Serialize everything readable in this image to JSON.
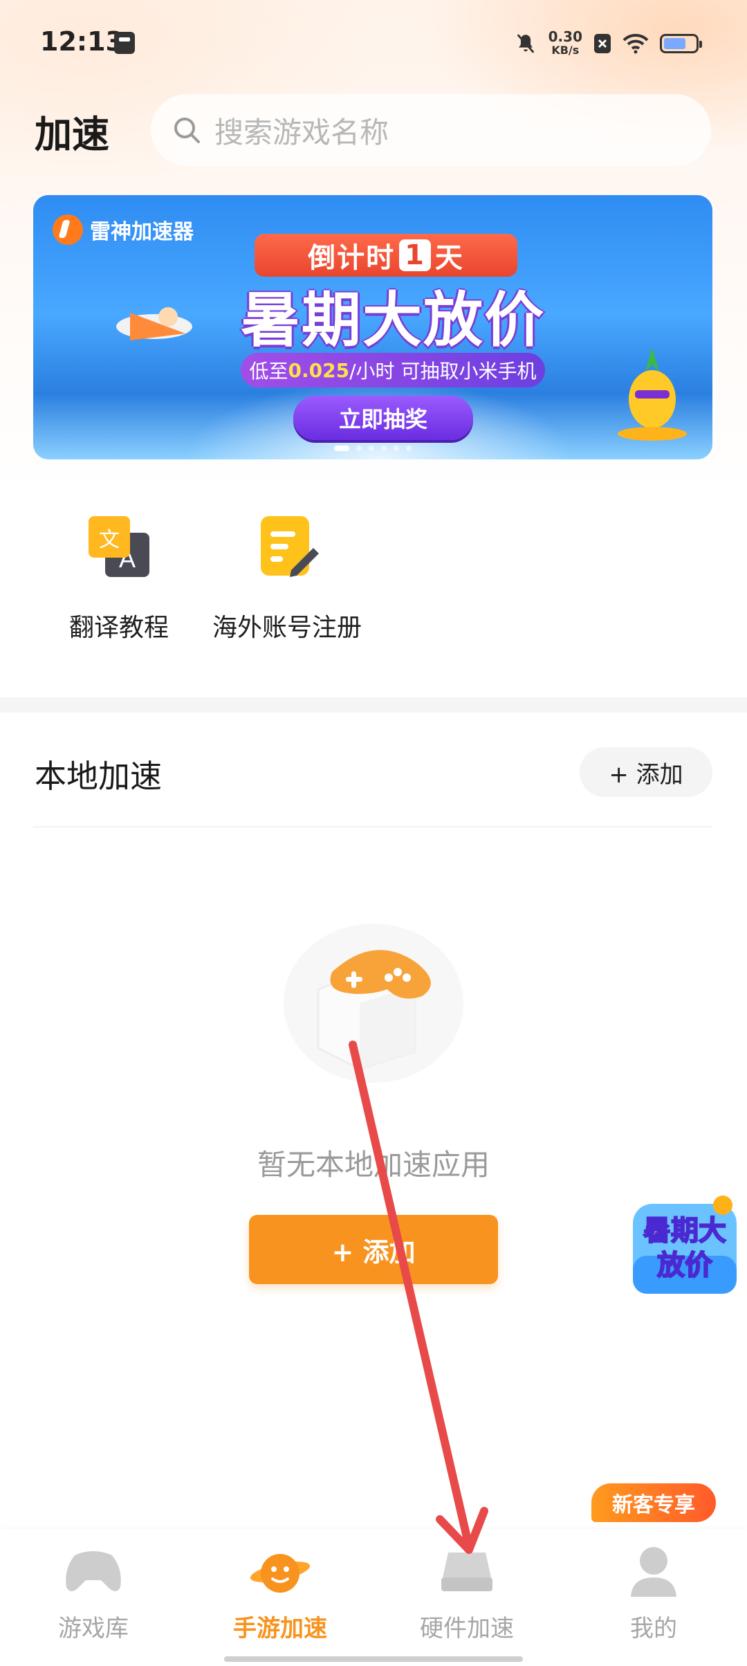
{
  "status_bar": {
    "time": "12:13",
    "net_speed": "0.30",
    "net_unit": "KB/s",
    "battery_level": 0.7
  },
  "header": {
    "title": "加速",
    "search_placeholder": "搜索游戏名称"
  },
  "banner": {
    "brand": "雷神加速器",
    "countdown_prefix": "倒计时",
    "countdown_num": "1",
    "countdown_suffix": "天",
    "headline": "暑期大放价",
    "sub_prefix": "低至",
    "sub_price": "0.025",
    "sub_suffix": "/小时 可抽取小米手机",
    "cta": "立即抽奖",
    "page_count": 6,
    "active_page": 0
  },
  "shortcuts": [
    {
      "label": "翻译教程",
      "icon": "translate-icon"
    },
    {
      "label": "海外账号注册",
      "icon": "note-edit-icon"
    }
  ],
  "local": {
    "title": "本地加速",
    "add_pill": "+ 添加",
    "empty_text": "暂无本地加速应用",
    "add_button": "+ 添加"
  },
  "float_promo": {
    "line1": "暑期大",
    "line2": "放价"
  },
  "bottom_nav": {
    "badge": "新客专享",
    "items": [
      {
        "label": "游戏库",
        "icon": "gamepad-icon",
        "active": false
      },
      {
        "label": "手游加速",
        "icon": "planet-face-icon",
        "active": true
      },
      {
        "label": "硬件加速",
        "icon": "console-icon",
        "active": false
      },
      {
        "label": "我的",
        "icon": "person-icon",
        "active": false
      }
    ]
  },
  "colors": {
    "accent": "#f7931e",
    "annotation": "#e84a4a"
  }
}
